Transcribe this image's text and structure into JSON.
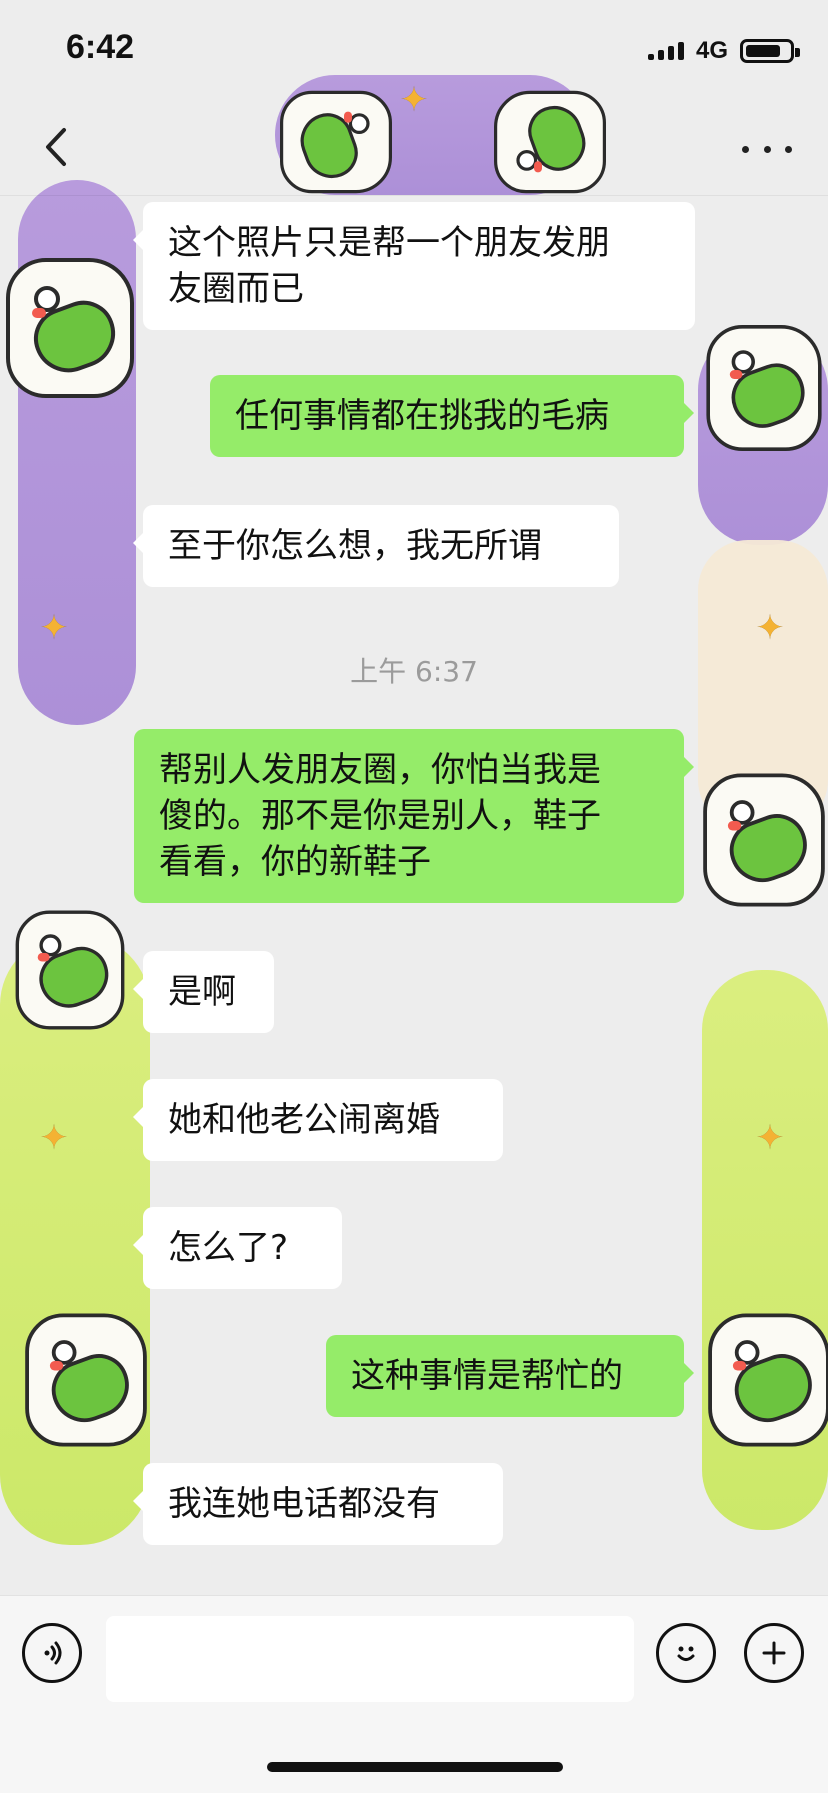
{
  "status_bar": {
    "time": "6:42",
    "network": "4G",
    "battery_level_percent": 75
  },
  "nav": {
    "title": "",
    "back_icon": "chevron-left-icon",
    "more_icon": "more-dots-icon"
  },
  "messages": [
    {
      "side": "left",
      "text": "这个照片只是帮一个朋友发朋\n友圈而已"
    },
    {
      "side": "right",
      "text": "任何事情都在挑我的毛病"
    },
    {
      "side": "left",
      "text": "至于你怎么想，我无所谓"
    },
    {
      "type": "timestamp",
      "text": "上午 6:37"
    },
    {
      "side": "right",
      "text": "帮别人发朋友圈，你怕当我是\n傻的。那不是你是别人，鞋子\n看看，你的新鞋子"
    },
    {
      "side": "left",
      "text": "是啊"
    },
    {
      "side": "left",
      "text": "她和他老公闹离婚"
    },
    {
      "side": "left",
      "text": "怎么了?"
    },
    {
      "side": "right",
      "text": "这种事情是帮忙的"
    },
    {
      "side": "left",
      "text": "我连她电话都没有"
    }
  ],
  "input_bar": {
    "voice_icon": "voice-icon",
    "text_value": "",
    "emoji_icon": "emoji-icon",
    "plus_icon": "plus-icon"
  },
  "colors": {
    "chat_bg": "#ededed",
    "bubble_left": "#ffffff",
    "bubble_right": "#95ec69",
    "timestamp": "#9b9b9b",
    "decoration_purple": "#a98bd6",
    "decoration_lime": "#c9e85d",
    "sticker_green": "#6cc43f",
    "sparkle_orange": "#f4b233"
  }
}
